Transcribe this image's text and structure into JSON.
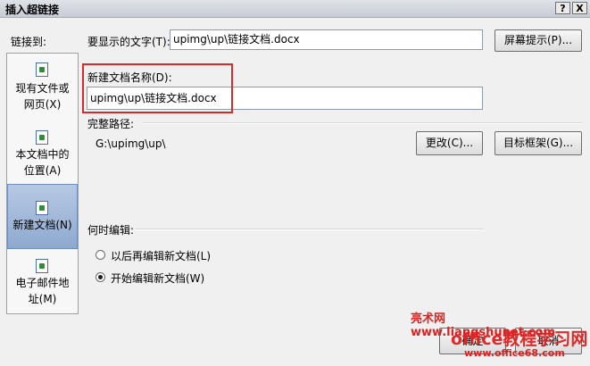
{
  "window": {
    "title": "插入超链接",
    "help_btn": "?",
    "close_btn": "X"
  },
  "link_to": {
    "label": "链接到:",
    "items": [
      {
        "label": "现有文件或网页(X)",
        "selected": false,
        "icon": "web-page-icon"
      },
      {
        "label": "本文档中的位置(A)",
        "selected": false,
        "icon": "place-in-doc-icon"
      },
      {
        "label": "新建文档(N)",
        "selected": true,
        "icon": "new-doc-icon"
      },
      {
        "label": "电子邮件地址(M)",
        "selected": false,
        "icon": "email-icon"
      }
    ]
  },
  "display_text": {
    "label": "要显示的文字(T):",
    "value": "upimg\\up\\链接文档.docx"
  },
  "screen_tip_button": "屏幕提示(P)...",
  "new_doc_name": {
    "label": "新建文档名称(D):",
    "value": "upimg\\up\\链接文档.docx"
  },
  "full_path": {
    "label": "完整路径:",
    "value": "G:\\upimg\\up\\"
  },
  "change_button": "更改(C)...",
  "target_frame_button": "目标框架(G)...",
  "when_to_edit": {
    "label": "何时编辑:",
    "options": [
      {
        "label": "以后再编辑新文档(L)",
        "selected": false
      },
      {
        "label": "开始编辑新文档(W)",
        "selected": true
      }
    ]
  },
  "ok_button": "确定",
  "cancel_button": "取消",
  "watermark": {
    "line1": "亮术网 www.liangshunet.com",
    "line2": "office教程学习网",
    "line3": "www.office68.com"
  }
}
